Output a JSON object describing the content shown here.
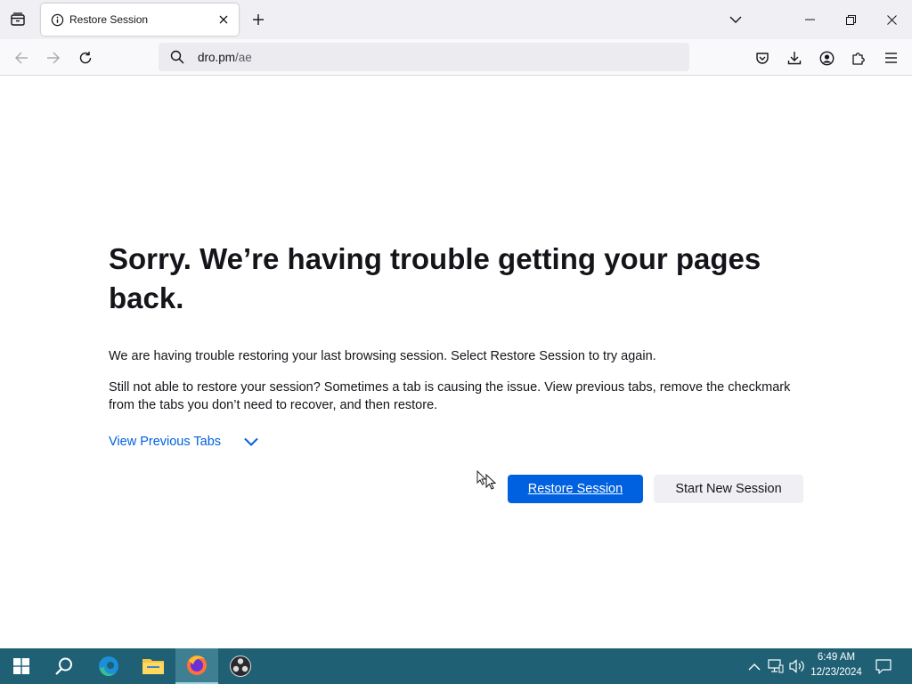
{
  "browser": {
    "tab": {
      "title": "Restore Session",
      "icon": "info-icon"
    },
    "url": {
      "domain": "dro.pm",
      "path": "/ae"
    }
  },
  "page": {
    "heading": "Sorry. We’re having trouble getting your pages back.",
    "paragraph1": "We are having trouble restoring your last browsing session. Select Restore Session to try again.",
    "paragraph2": "Still not able to restore your session? Sometimes a tab is causing the issue. View previous tabs, remove the checkmark from the tabs you don’t need to recover, and then restore.",
    "view_previous_tabs": "View Previous Tabs",
    "restore_button": "Restore Session",
    "new_session_button": "Start New Session"
  },
  "taskbar": {
    "time": "6:49 AM",
    "date": "12/23/2024"
  },
  "colors": {
    "accent": "#0061e0",
    "taskbar": "#1f6074"
  }
}
